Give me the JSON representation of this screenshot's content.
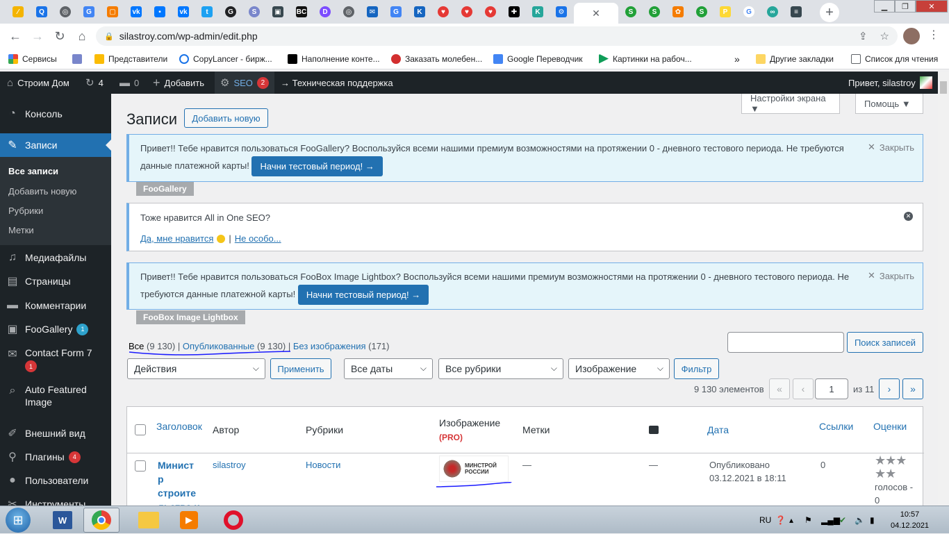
{
  "browser": {
    "url": "silastroy.com/wp-admin/edit.php",
    "bookmarks": [
      {
        "label": "Сервисы",
        "color": "#4285f4"
      },
      {
        "label": "",
        "color": "#7986cb"
      },
      {
        "label": "Представители",
        "color": "#fbbc04"
      },
      {
        "label": "CopyLancer - бирж...",
        "color": "#1a73e8"
      },
      {
        "label": "Наполнение конте...",
        "color": "#000000"
      },
      {
        "label": "Заказать молебен...",
        "color": "#d32f2f"
      },
      {
        "label": "Google Переводчик",
        "color": "#4285f4"
      },
      {
        "label": "Картинки на рабоч...",
        "color": "#0f9d58"
      }
    ],
    "more_bookmarks": "»",
    "other_bookmarks": "Другие закладки",
    "reading_list": "Список для чтения",
    "new_tab": "+"
  },
  "adminbar": {
    "site_name": "Строим Дом",
    "updates_count": "4",
    "comments_count": "0",
    "add_new": "Добавить",
    "seo": "SEO",
    "seo_count": "2",
    "support": "→ Техническая поддержка",
    "greeting": "Привет, silastroy"
  },
  "sidebar": {
    "items": [
      {
        "label": "Консоль",
        "icon": "dashboard-icon"
      },
      {
        "label": "Записи",
        "icon": "pin-icon"
      },
      {
        "label": "Медиафайлы",
        "icon": "media-icon"
      },
      {
        "label": "Страницы",
        "icon": "pages-icon"
      },
      {
        "label": "Комментарии",
        "icon": "comments-icon"
      },
      {
        "label": "FooGallery",
        "icon": "gallery-icon",
        "badge": "1"
      },
      {
        "label": "Contact Form 7",
        "icon": "mail-icon",
        "badge": "1"
      },
      {
        "label": "Auto Featured Image",
        "icon": "search-image-icon"
      },
      {
        "label": "Внешний вид",
        "icon": "brush-icon"
      },
      {
        "label": "Плагины",
        "icon": "plugin-icon",
        "badge": "4"
      },
      {
        "label": "Пользователи",
        "icon": "users-icon"
      },
      {
        "label": "Инструменты",
        "icon": "tools-icon"
      }
    ],
    "submenu": [
      "Все записи",
      "Добавить новую",
      "Рубрики",
      "Метки"
    ]
  },
  "page": {
    "title": "Записи",
    "add_new": "Добавить новую",
    "screen_options": "Настройки экрана ▼",
    "help": "Помощь ▼"
  },
  "notices": {
    "foogallery_text1": "Привет!! Тебе нравится пользоваться FooGallery? Воспользуйся всеми нашими премиум возможностями на протяжении 0 - дневного тестового периода. Не требуются",
    "foogallery_text2": "данные платежной карты!",
    "foogallery_button": "Начни тестовый период! →",
    "foogallery_tag": "FooGallery",
    "dismiss": "Закрыть",
    "aioseo_question": "Тоже нравится All in One SEO?",
    "aioseo_yes": "Да, мне нравится",
    "aioseo_sep": "|",
    "aioseo_no": "Не особо...",
    "foobox_text1": "Привет!! Тебе нравится пользоваться FooBox Image Lightbox? Воспользуйся всеми нашими премиум возможностями на протяжении 0 - дневного тестового периода. Не",
    "foobox_text2": "требуются данные платежной карты!",
    "foobox_button": "Начни тестовый период! →",
    "foobox_tag": "FooBox Image Lightbox"
  },
  "views": {
    "all": "Все",
    "all_count": "(9 130)",
    "published": "Опубликованные",
    "published_count": "(9 130)",
    "no_image": "Без изображения",
    "no_image_count": "(171)",
    "sep": "|"
  },
  "search": {
    "button": "Поиск записей",
    "value": ""
  },
  "filters": {
    "bulk_actions": "Действия",
    "apply": "Применить",
    "dates": "Все даты",
    "categories": "Все рубрики",
    "image": "Изображение",
    "filter": "Фильтр"
  },
  "pagination": {
    "items": "9 130 элементов",
    "first": "«",
    "prev": "‹",
    "current": "1",
    "of": "из 11",
    "next": "›",
    "last": "»"
  },
  "table": {
    "columns": {
      "title": "Заголовок",
      "author": "Автор",
      "categories": "Рубрики",
      "image": "Изображение",
      "image_pro": "(PRO)",
      "tags": "Метки",
      "date": "Дата",
      "links": "Ссылки",
      "ratings": "Оценки"
    },
    "rows": [
      {
        "title_lines": [
          "Минист",
          "р",
          "строите",
          "льства и"
        ],
        "author": "silastroy",
        "category": "Новости",
        "image_text": "МИНСТРОЙ РОССИИ",
        "tags": "—",
        "comments": "—",
        "status": "Опубликовано",
        "date": "03.12.2021 в 18:11",
        "links": "0",
        "votes": "голосов -",
        "votes_count": "0",
        "stars": "★★★"
      }
    ]
  },
  "taskbar": {
    "lang": "RU",
    "time": "10:57",
    "date": "04.12.2021"
  }
}
